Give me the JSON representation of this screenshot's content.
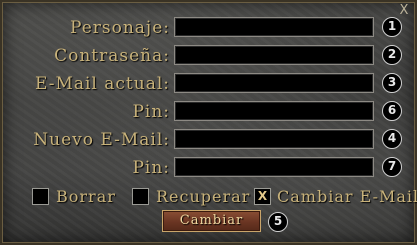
{
  "window": {
    "close_glyph": "X"
  },
  "form": {
    "rows": [
      {
        "label": "Personaje:",
        "value": "",
        "badge": "1"
      },
      {
        "label": "Contraseña:",
        "value": "",
        "badge": "2"
      },
      {
        "label": "E-Mail actual:",
        "value": "",
        "badge": "3"
      },
      {
        "label": "Pin:",
        "value": "",
        "badge": "6"
      },
      {
        "label": "Nuevo E-Mail:",
        "value": "",
        "badge": "4"
      },
      {
        "label": "Pin:",
        "value": "",
        "badge": "7"
      }
    ],
    "options": [
      {
        "label": "Borrar",
        "checked": false,
        "mark": ""
      },
      {
        "label": "Recuperar",
        "checked": false,
        "mark": ""
      },
      {
        "label": "Cambiar E-Mail",
        "checked": true,
        "mark": "X"
      }
    ],
    "submit": {
      "label": "Cambiar",
      "badge": "5"
    }
  }
}
